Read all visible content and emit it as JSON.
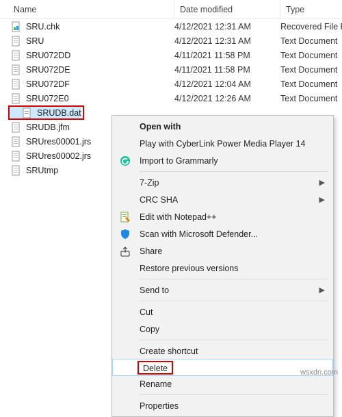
{
  "header": {
    "name": "Name",
    "date": "Date modified",
    "type": "Type"
  },
  "files": [
    {
      "name": "SRU.chk",
      "date": "4/12/2021 12:31 AM",
      "type": "Recovered File Fr",
      "icon": "chk"
    },
    {
      "name": "SRU",
      "date": "4/12/2021 12:31 AM",
      "type": "Text Document",
      "icon": "txt"
    },
    {
      "name": "SRU072DD",
      "date": "4/11/2021 11:58 PM",
      "type": "Text Document",
      "icon": "txt"
    },
    {
      "name": "SRU072DE",
      "date": "4/11/2021 11:58 PM",
      "type": "Text Document",
      "icon": "txt"
    },
    {
      "name": "SRU072DF",
      "date": "4/12/2021 12:04 AM",
      "type": "Text Document",
      "icon": "txt"
    },
    {
      "name": "SRU072E0",
      "date": "4/12/2021 12:26 AM",
      "type": "Text Document",
      "icon": "txt"
    },
    {
      "name": "SRUDB.dat",
      "date": "",
      "type": "",
      "icon": "dat",
      "selected": true
    },
    {
      "name": "SRUDB.jfm",
      "date": "",
      "type": "",
      "icon": "txt"
    },
    {
      "name": "SRUres00001.jrs",
      "date": "",
      "type": "",
      "icon": "txt"
    },
    {
      "name": "SRUres00002.jrs",
      "date": "",
      "type": "",
      "icon": "txt"
    },
    {
      "name": "SRUtmp",
      "date": "",
      "type": "",
      "icon": "txt"
    }
  ],
  "menu": {
    "open_with": "Open with",
    "cyberlink": "Play with CyberLink Power Media Player 14",
    "grammarly": "Import to Grammarly",
    "seven_zip": "7-Zip",
    "crc_sha": "CRC SHA",
    "notepad": "Edit with Notepad++",
    "defender": "Scan with Microsoft Defender...",
    "share": "Share",
    "restore": "Restore previous versions",
    "send_to": "Send to",
    "cut": "Cut",
    "copy": "Copy",
    "shortcut": "Create shortcut",
    "delete": "Delete",
    "rename": "Rename",
    "properties": "Properties"
  },
  "watermark": "wsxdn.com"
}
